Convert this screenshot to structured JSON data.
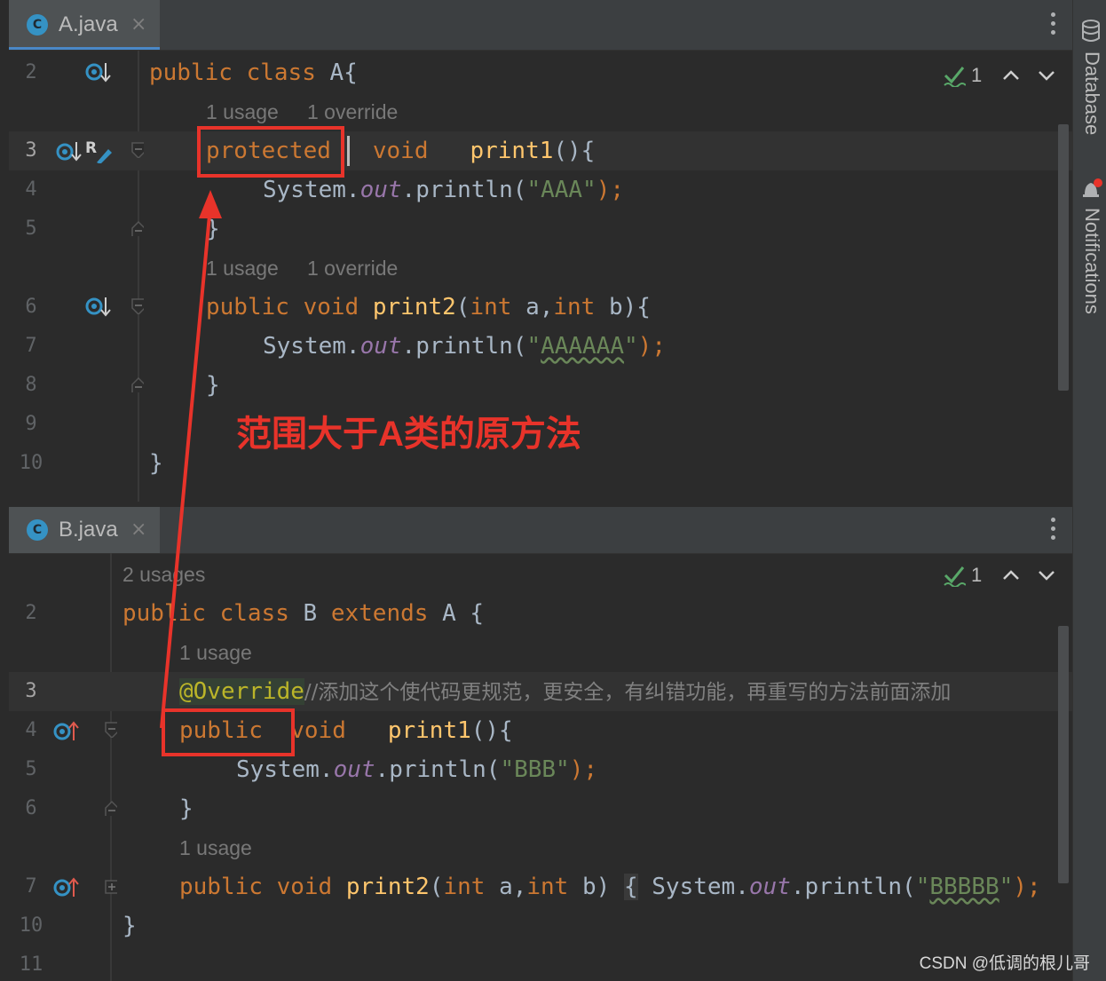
{
  "pane_a": {
    "tab": {
      "icon": "C",
      "label": "A.java"
    },
    "hint_line_3": {
      "usage": "1 usage",
      "override": "1 override"
    },
    "hint_line_6": {
      "usage": "1 usage",
      "override": "1 override"
    },
    "line_numbers": [
      "2",
      "3",
      "4",
      "5",
      "6",
      "7",
      "8",
      "9",
      "10"
    ],
    "inspection": {
      "count": "1"
    },
    "code": {
      "l2": [
        "public",
        "class",
        "A{"
      ],
      "l3": [
        "protected",
        "void",
        "print1",
        "(){"
      ],
      "l4": [
        "System.",
        "out",
        ".println(",
        "\"AAA\"",
        ");"
      ],
      "l5": [
        "}"
      ],
      "l6": [
        "public",
        "void",
        "print2",
        "(",
        "int",
        "a,",
        "int",
        "b){"
      ],
      "l7": [
        "System.",
        "out",
        ".println(",
        "\"",
        "AAAAAA",
        "\"",
        ");"
      ],
      "l8": [
        "}"
      ],
      "l10": [
        "}"
      ]
    }
  },
  "annotation": "范围大于A类的原方法",
  "pane_b": {
    "tab": {
      "icon": "C",
      "label": "B.java"
    },
    "hint_top": "2 usages",
    "hint_line_3": "1 usage",
    "hint_line_7": "1 usage",
    "line_numbers": [
      "2",
      "3",
      "4",
      "5",
      "6",
      "7",
      "10",
      "11"
    ],
    "inspection": {
      "count": "1"
    },
    "code": {
      "l2": [
        "public",
        "class",
        "B",
        "extends",
        "A",
        "{"
      ],
      "l3": [
        "@Override",
        "//添加这个使代码更规范，更安全，有纠错功能，再重写的方法前面添加"
      ],
      "l4": [
        "public",
        "void",
        "print1",
        "(){"
      ],
      "l5": [
        "System.",
        "out",
        ".println(",
        "\"BBB\"",
        ");"
      ],
      "l6": [
        "}"
      ],
      "l7": [
        "public",
        "void",
        "print2",
        "(",
        "int",
        "a,",
        "int",
        "b)",
        "{",
        "System.",
        "out",
        ".println(",
        "\"",
        "BBBBB",
        "\"",
        ");"
      ],
      "l10": [
        "}"
      ]
    }
  },
  "right_sidebar": {
    "database": "Database",
    "notifications": "Notifications"
  },
  "watermark": "CSDN @低调的根儿哥",
  "colors": {
    "accent_red": "#e8332a",
    "keyword": "#cc7832",
    "function": "#ffc66d",
    "string": "#6a8759",
    "field": "#9876aa",
    "annotation": "#bbb529",
    "comment": "#808080",
    "background": "#2b2b2b"
  }
}
